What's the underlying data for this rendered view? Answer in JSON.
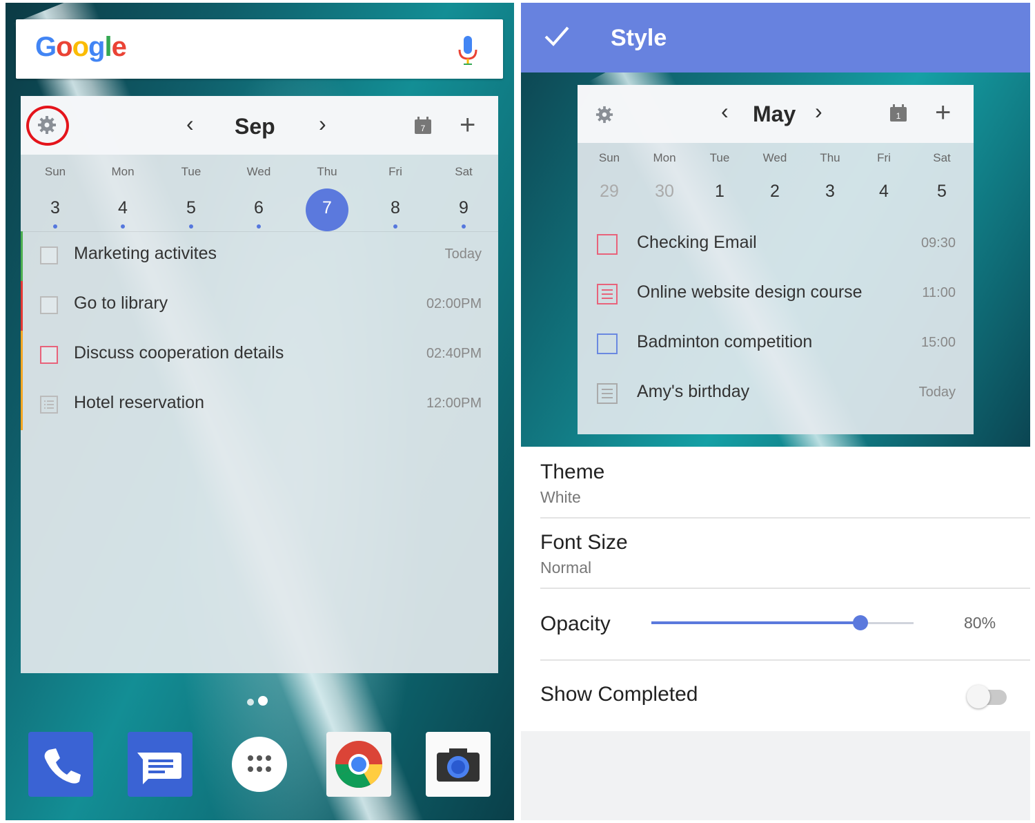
{
  "left_screen": {
    "search": {
      "logo_text": [
        "G",
        "o",
        "o",
        "g",
        "l",
        "e"
      ],
      "logo_colors": [
        "#4285F4",
        "#EA4335",
        "#FBBC05",
        "#4285F4",
        "#34A853",
        "#EA4335"
      ],
      "mic_icon": "mic-icon"
    },
    "widget": {
      "month": "Sep",
      "prev_label": "‹",
      "next_label": "›",
      "calendar_badge": "7",
      "add_label": "+",
      "weekdays": [
        "Sun",
        "Mon",
        "Tue",
        "Wed",
        "Thu",
        "Fri",
        "Sat"
      ],
      "days": [
        "3",
        "4",
        "5",
        "6",
        "7",
        "8",
        "9"
      ],
      "selected_day": "7",
      "tasks": [
        {
          "name": "Marketing activites",
          "time": "Today",
          "bar_color": "#4caf50",
          "box_color": "#bbbbbb",
          "icon": "checkbox"
        },
        {
          "name": "Go to library",
          "time": "02:00PM",
          "bar_color": "#e53935",
          "box_color": "#bbbbbb",
          "icon": "checkbox"
        },
        {
          "name": "Discuss cooperation details",
          "time": "02:40PM",
          "bar_color": "#f5a623",
          "box_color": "#e8627a",
          "icon": "checkbox"
        },
        {
          "name": "Hotel reservation",
          "time": "12:00PM",
          "bar_color": "#f5a623",
          "box_color": "#bbbbbb",
          "icon": "list"
        }
      ]
    },
    "dock": [
      "phone-icon",
      "messages-icon",
      "app-drawer-icon",
      "chrome-icon",
      "camera-icon"
    ]
  },
  "right_screen": {
    "appbar": {
      "title": "Style"
    },
    "preview": {
      "month": "May",
      "prev_label": "‹",
      "next_label": "›",
      "calendar_badge": "1",
      "add_label": "+",
      "weekdays": [
        "Sun",
        "Mon",
        "Tue",
        "Wed",
        "Thu",
        "Fri",
        "Sat"
      ],
      "days": [
        "29",
        "30",
        "1",
        "2",
        "3",
        "4",
        "5"
      ],
      "tasks": [
        {
          "name": "Checking Email",
          "time": "09:30",
          "box_color": "#e8627a",
          "icon": "checkbox"
        },
        {
          "name": "Online website design course",
          "time": "11:00",
          "box_color": "#e8627a",
          "icon": "list"
        },
        {
          "name": "Badminton competition",
          "time": "15:00",
          "box_color": "#6a88e0",
          "icon": "checkbox"
        },
        {
          "name": "Amy's birthday",
          "time": "Today",
          "box_color": "#aaaaaa",
          "icon": "list"
        }
      ]
    },
    "settings": {
      "theme_label": "Theme",
      "theme_value": "White",
      "font_label": "Font Size",
      "font_value": "Normal",
      "opacity_label": "Opacity",
      "opacity_value": "80%",
      "opacity_fraction": 0.8,
      "completed_label": "Show Completed",
      "completed_on": false
    },
    "accent_color": "#6782df"
  }
}
